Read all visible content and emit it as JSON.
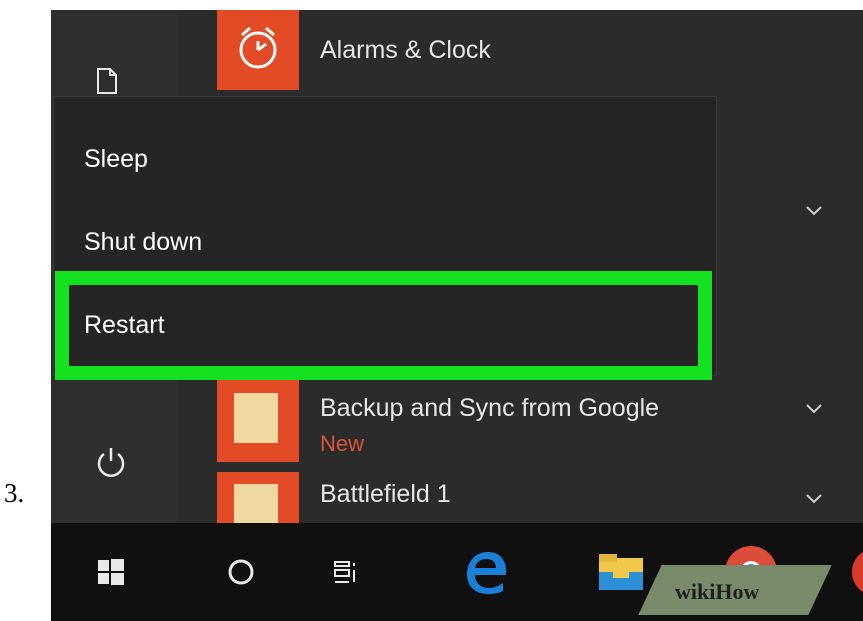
{
  "step": {
    "number": "3."
  },
  "apps": [
    {
      "name": "Alarms & Clock",
      "icon": "alarm-clock-icon",
      "badge": ""
    },
    {
      "name": "Backup and Sync from Google",
      "icon": "folder-icon",
      "badge": "New"
    },
    {
      "name": "Battlefield 1",
      "icon": "folder-icon",
      "badge": ""
    }
  ],
  "power_menu": {
    "items": [
      "Sleep",
      "Shut down",
      "Restart"
    ],
    "highlighted": "Restart"
  },
  "rail": {
    "icons": [
      "document-icon",
      "power-icon"
    ]
  },
  "taskbar": {
    "icons": [
      "windows-start-icon",
      "cortana-search-icon",
      "task-view-icon",
      "edge-browser-icon",
      "file-explorer-icon",
      "chrome-icon"
    ]
  },
  "watermark": {
    "text": "wikiHow"
  },
  "colors": {
    "highlight": "#14e11f",
    "tile": "#e24b26",
    "badge": "#d9573a"
  }
}
